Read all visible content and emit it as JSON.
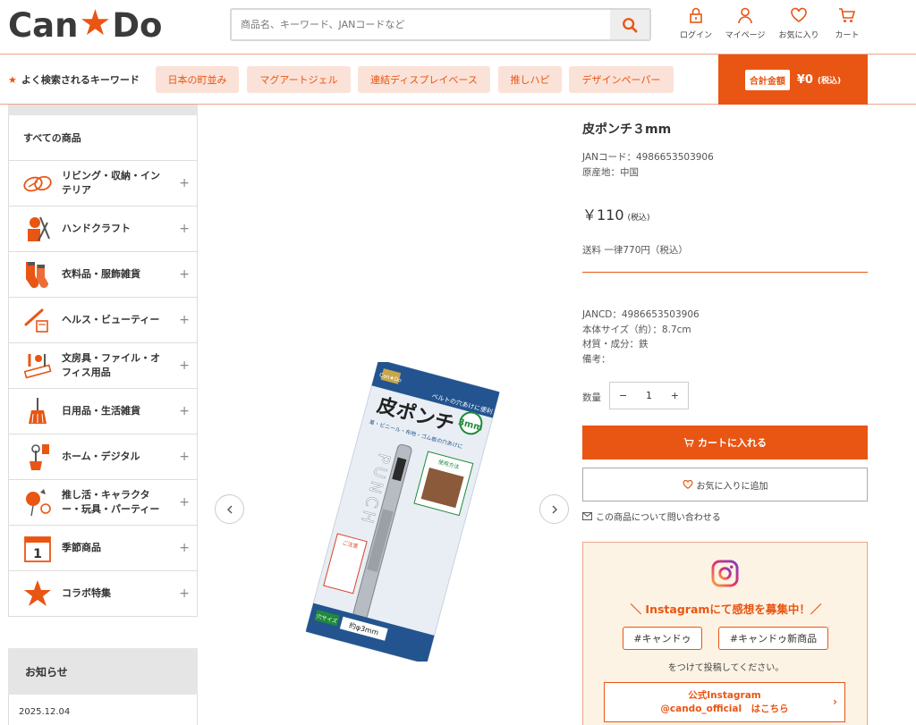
{
  "header": {
    "logo_left": "Can",
    "logo_right": "Do",
    "search_placeholder": "商品名、キーワード、JANコードなど",
    "nav": [
      {
        "label": "ログイン",
        "icon": "lock-icon"
      },
      {
        "label": "マイページ",
        "icon": "user-icon"
      },
      {
        "label": "お気に入り",
        "icon": "heart-icon"
      },
      {
        "label": "カート",
        "icon": "cart-icon"
      }
    ]
  },
  "keyword_bar": {
    "title": "よく検索されるキーワード",
    "keywords": [
      "日本の町並み",
      "マグアートジェル",
      "連結ディスプレイベース",
      "推しハピ",
      "デザインペーパー"
    ],
    "total_label": "合計金額",
    "total_value": "¥0",
    "total_tax": "(税込)"
  },
  "sidebar": {
    "all_label": "すべての商品",
    "categories": [
      {
        "label": "リビング・収納・インテリア",
        "icon": "living-icon"
      },
      {
        "label": "ハンドクラフト",
        "icon": "craft-icon"
      },
      {
        "label": "衣料品・服飾雑貨",
        "icon": "socks-icon"
      },
      {
        "label": "ヘルス・ビューティー",
        "icon": "beauty-icon"
      },
      {
        "label": "文房具・ファイル・オフィス用品",
        "icon": "stationery-icon"
      },
      {
        "label": "日用品・生活雑貨",
        "icon": "broom-icon"
      },
      {
        "label": "ホーム・デジタル",
        "icon": "home-digital-icon"
      },
      {
        "label": "推し活・キャラクター・玩具・パーティー",
        "icon": "party-icon"
      },
      {
        "label": "季節商品",
        "icon": "calendar-icon"
      },
      {
        "label": "コラボ特集",
        "icon": "star-icon"
      }
    ],
    "expand_symbol": "+"
  },
  "news": {
    "title": "お知らせ",
    "date": "2025.12.04"
  },
  "product_image": {
    "brand_tag": "Can★Do",
    "catch": "ベルトの穴あけに便利",
    "name": "皮ポンチ",
    "size_badge": "3mm",
    "sub": "革・ビニール・布地・ゴム板の穴あけに",
    "punch_word": "PUNCH",
    "usage": "使用方法",
    "caution": "ご注意",
    "hole_size_label": "穴サイズ",
    "hole_size_value": "約φ3mm"
  },
  "product": {
    "title": "皮ポンチ３mm",
    "jan": "JANコード：4986653503906",
    "origin": "原産地：中国",
    "price": "￥110",
    "price_tax": "(税込)",
    "shipping": "送料 一律770円（税込）",
    "jancd": "JANCD：4986653503906",
    "size": "本体サイズ（約）：8.7cm",
    "material": "材質・成分：鉄",
    "note": "備考：",
    "qty_label": "数量",
    "qty_minus": "−",
    "qty_value": "1",
    "qty_plus": "+",
    "cart_button": "カートに入れる",
    "fav_button": "お気に入りに追加",
    "inquiry": "この商品について問い合わせる"
  },
  "instagram": {
    "title": "＼ Instagramにて感想を募集中！／",
    "tags": [
      "#キャンドゥ",
      "#キャンドゥ新商品"
    ],
    "note": "をつけて投稿してください。",
    "link_line1": "公式Instagram",
    "link_line2": "@cando_official　はこちら"
  },
  "colors": {
    "accent": "#e95513",
    "keyword_bg": "#fbe2d8",
    "insta_bg": "#fdf3e4"
  }
}
